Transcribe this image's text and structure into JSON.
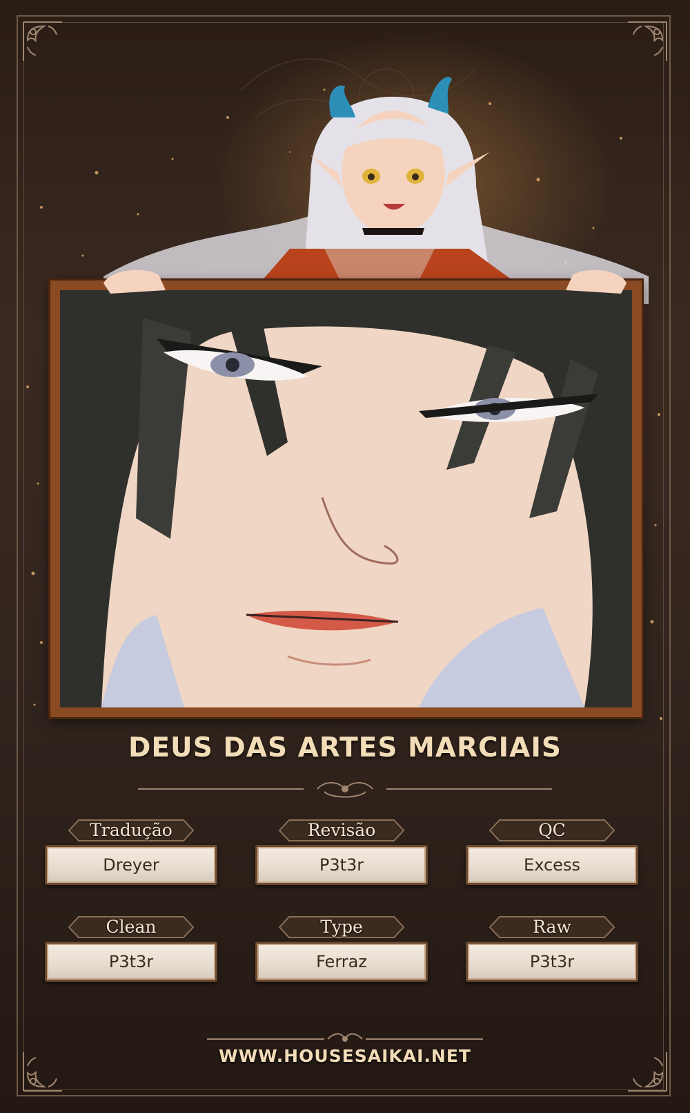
{
  "title": "DEUS DAS ARTES MARCIAIS",
  "credits": [
    {
      "role": "Tradução",
      "name": "Dreyer"
    },
    {
      "role": "Revisão",
      "name": "P3t3r"
    },
    {
      "role": "QC",
      "name": "Excess"
    },
    {
      "role": "Clean",
      "name": "P3t3r"
    },
    {
      "role": "Type",
      "name": "Ferraz"
    },
    {
      "role": "Raw",
      "name": "P3t3r"
    }
  ],
  "website": "WWW.HOUSESAIKAI.NET",
  "colors": {
    "background": "#2a1d16",
    "frame_wood": "#8a4a22",
    "title_text": "#f3ddb8",
    "name_box": "#f4ece2"
  },
  "icons": [
    "ornament-corner-icon",
    "ornament-divider-icon"
  ]
}
